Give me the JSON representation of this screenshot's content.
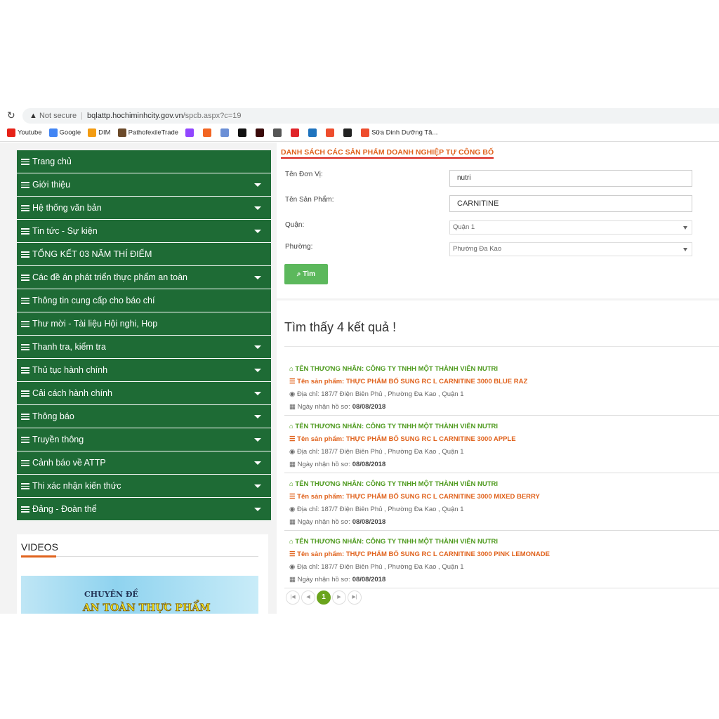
{
  "browser": {
    "security": "Not secure",
    "url_host": "bqlattp.hochiminhcity.gov.vn",
    "url_path": "/spcb.aspx?c=19",
    "bookmarks": [
      {
        "label": "Youtube",
        "color": "#e62117"
      },
      {
        "label": "Google",
        "color": "#4285f4"
      },
      {
        "label": "DIM",
        "color": "#f39c12"
      },
      {
        "label": "PathofexileTrade",
        "color": "#6b4a2a"
      },
      {
        "label": "",
        "color": "#9146ff"
      },
      {
        "label": "",
        "color": "#f26522"
      },
      {
        "label": "",
        "color": "#6b8fd6"
      },
      {
        "label": "",
        "color": "#111"
      },
      {
        "label": "",
        "color": "#3a0a0a"
      },
      {
        "label": "",
        "color": "#555"
      },
      {
        "label": "",
        "color": "#e0242a"
      },
      {
        "label": "",
        "color": "#1e73be"
      },
      {
        "label": "",
        "color": "#ee4d2d"
      },
      {
        "label": "",
        "color": "#222"
      },
      {
        "label": "Sữa Dinh Dưỡng Tă...",
        "color": "#ee4d2d"
      }
    ]
  },
  "sidebar": {
    "items": [
      {
        "label": "Trang chủ",
        "has_sub": false
      },
      {
        "label": "Giới thiệu",
        "has_sub": true
      },
      {
        "label": "Hệ thống văn bản",
        "has_sub": true
      },
      {
        "label": "Tin tức - Sự kiện",
        "has_sub": true
      },
      {
        "label": "TỔNG KẾT 03 NĂM THÍ ĐIỂM",
        "has_sub": false
      },
      {
        "label": "Các đề án phát triển thực phẩm an toàn",
        "has_sub": true
      },
      {
        "label": "Thông tin cung cấp cho báo chí",
        "has_sub": false
      },
      {
        "label": "Thư mời - Tài liệu Hội nghi, Hop",
        "has_sub": false
      },
      {
        "label": "Thanh tra, kiểm tra",
        "has_sub": true
      },
      {
        "label": "Thủ tục hành chính",
        "has_sub": true
      },
      {
        "label": "Cải cách hành chính",
        "has_sub": true
      },
      {
        "label": "Thông báo",
        "has_sub": true
      },
      {
        "label": "Truyền thông",
        "has_sub": true
      },
      {
        "label": "Cảnh báo về ATTP",
        "has_sub": true
      },
      {
        "label": "Thi xác nhận kiến thức",
        "has_sub": true
      },
      {
        "label": "Đảng - Đoàn thể",
        "has_sub": true
      }
    ],
    "videos_title": "VIDEOS",
    "video_line1": "CHUYÊN ĐỀ",
    "video_line2": "AN TOÀN THỰC PHẨM"
  },
  "form": {
    "title": "DANH SÁCH CÁC SẢN PHẨM DOANH NGHIỆP TỰ CÔNG BỐ",
    "unit_label": "Tên Đơn Vị:",
    "unit_value": "nutri",
    "product_label": "Tên Sản Phẩm:",
    "product_value": "CARNITINE",
    "district_label": "Quận:",
    "district_value": "Quận 1",
    "ward_label": "Phường:",
    "ward_value": "Phường Đa Kao",
    "search_button": "Tìm"
  },
  "results": {
    "title": "Tìm thấy 4 kết quả !",
    "items": [
      {
        "merchant": "TÊN THƯƠNG NHÂN: CÔNG TY TNHH MỘT THÀNH VIÊN NUTRI",
        "product": "Tên sản phẩm: THỰC PHẨM BỔ SUNG RC L CARNITINE 3000 BLUE RAZ",
        "address": "Địa chỉ: 187/7 Điện Biên Phủ , Phường Đa Kao , Quận 1",
        "date_label": "Ngày nhận hồ sơ:",
        "date": "08/08/2018"
      },
      {
        "merchant": "TÊN THƯƠNG NHÂN: CÔNG TY TNHH MỘT THÀNH VIÊN NUTRI",
        "product": "Tên sản phẩm: THỰC PHẨM BỔ SUNG RC L CARNITINE 3000 APPLE",
        "address": "Địa chỉ: 187/7 Điện Biên Phủ , Phường Đa Kao , Quận 1",
        "date_label": "Ngày nhận hồ sơ:",
        "date": "08/08/2018"
      },
      {
        "merchant": "TÊN THƯƠNG NHÂN: CÔNG TY TNHH MỘT THÀNH VIÊN NUTRI",
        "product": "Tên sản phẩm: THỰC PHẨM BỔ SUNG RC L CARNITINE 3000 MIXED BERRY",
        "address": "Địa chỉ: 187/7 Điện Biên Phủ , Phường Đa Kao , Quận 1",
        "date_label": "Ngày nhận hồ sơ:",
        "date": "08/08/2018"
      },
      {
        "merchant": "TÊN THƯƠNG NHÂN: CÔNG TY TNHH MỘT THÀNH VIÊN NUTRI",
        "product": "Tên sản phẩm: THỰC PHẨM BỔ SUNG RC L CARNITINE 3000 PINK LEMONADE",
        "address": "Địa chỉ: 187/7 Điện Biên Phủ , Phường Đa Kao , Quận 1",
        "date_label": "Ngày nhận hồ sơ:",
        "date": "08/08/2018"
      }
    ],
    "current_page": "1"
  }
}
